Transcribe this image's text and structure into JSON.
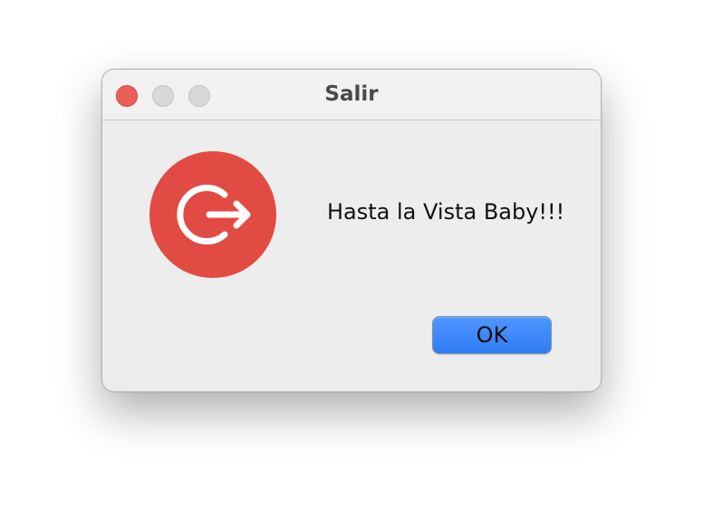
{
  "dialog": {
    "title": "Salir",
    "message": "Hasta la Vista Baby!!!",
    "ok_label": "OK",
    "icon": "exit-icon"
  },
  "colors": {
    "icon_background": "#e24b43",
    "icon_foreground": "#ffffff",
    "button_accent": "#3b86fb",
    "close_button": "#ec5f59",
    "inactive_traffic": "#d8d8d8",
    "window_background": "#ededed"
  }
}
